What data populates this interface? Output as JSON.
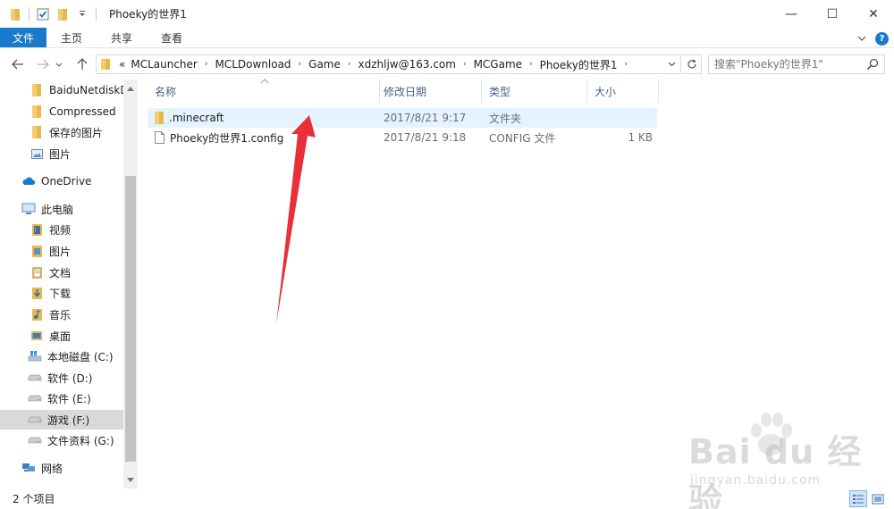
{
  "window": {
    "title": "Phoeky的世界1",
    "minimize_glyph": "—",
    "maximize_glyph": "☐",
    "close_glyph": "✕"
  },
  "ribbon": {
    "tabs": [
      "文件",
      "主页",
      "共享",
      "查看"
    ],
    "help": "?"
  },
  "address": {
    "overflow": "«",
    "crumbs": [
      "MCLauncher",
      "MCLDownload",
      "Game",
      "xdzhljw@163.com",
      "MCGame",
      "Phoeky的世界1"
    ],
    "separator": "›",
    "search_placeholder": "搜索\"Phoeky的世界1\""
  },
  "nav": {
    "items": [
      {
        "label": "BaiduNetdiskDo",
        "icon": "folder-icon"
      },
      {
        "label": "Compressed",
        "icon": "folder-icon"
      },
      {
        "label": "保存的图片",
        "icon": "folder-icon"
      },
      {
        "label": "图片",
        "icon": "pictures-icon"
      },
      {
        "label": "OneDrive",
        "icon": "cloud-icon"
      },
      {
        "label": "此电脑",
        "icon": "computer-icon"
      },
      {
        "label": "视频",
        "icon": "videos-icon"
      },
      {
        "label": "图片",
        "icon": "pictures-icon"
      },
      {
        "label": "文档",
        "icon": "documents-icon"
      },
      {
        "label": "下载",
        "icon": "downloads-icon"
      },
      {
        "label": "音乐",
        "icon": "music-icon"
      },
      {
        "label": "桌面",
        "icon": "desktop-icon"
      },
      {
        "label": "本地磁盘 (C:)",
        "icon": "system-drive-icon"
      },
      {
        "label": "软件 (D:)",
        "icon": "drive-icon"
      },
      {
        "label": "软件 (E:)",
        "icon": "drive-icon"
      },
      {
        "label": "游戏 (F:)",
        "icon": "drive-icon"
      },
      {
        "label": "文件资料 (G:)",
        "icon": "drive-icon"
      },
      {
        "label": "网络",
        "icon": "network-icon"
      }
    ]
  },
  "columns": {
    "name": "名称",
    "date": "修改日期",
    "type": "类型",
    "size": "大小"
  },
  "files": [
    {
      "name": ".minecraft",
      "date": "2017/8/21 9:17",
      "type": "文件夹",
      "size": "",
      "icon": "folder-icon"
    },
    {
      "name": "Phoeky的世界1.config",
      "date": "2017/8/21 9:18",
      "type": "CONFIG 文件",
      "size": "1 KB",
      "icon": "file-icon"
    }
  ],
  "status": {
    "count": "2 个项目"
  },
  "watermark": {
    "brand": "Bai du 经验",
    "url": "jingyan.baidu.com"
  },
  "colors": {
    "accent": "#1979ca",
    "folder": "#e8b84a",
    "selection": "#e5f3ff",
    "arrow": "#e8303a"
  }
}
